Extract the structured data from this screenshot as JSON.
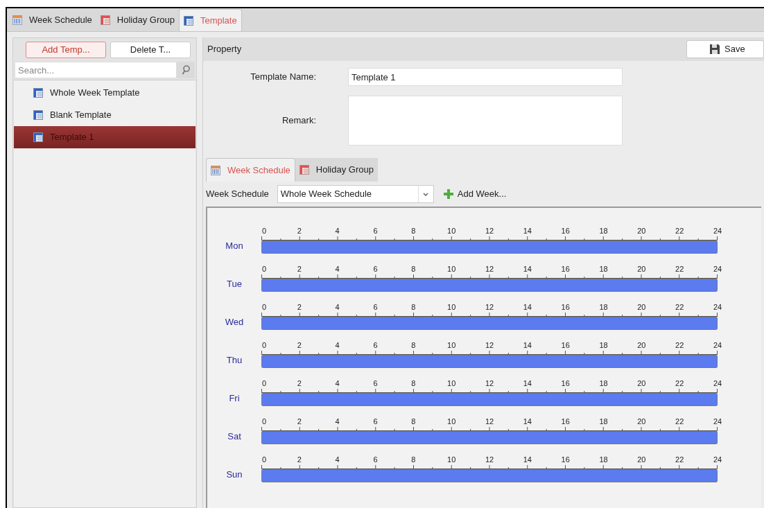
{
  "top_tabs": [
    {
      "label": "Week Schedule",
      "kind": "week",
      "selected": false
    },
    {
      "label": "Holiday Group",
      "kind": "holiday",
      "selected": false
    },
    {
      "label": "Template",
      "kind": "template",
      "selected": true
    }
  ],
  "sidebar": {
    "buttons": [
      {
        "label": "Add Temp...",
        "primary": true
      },
      {
        "label": "Delete T...",
        "primary": false
      }
    ],
    "search": {
      "placeholder": "Search..."
    },
    "items": [
      {
        "label": "Whole Week Template",
        "selected": false
      },
      {
        "label": "Blank Template",
        "selected": false
      },
      {
        "label": "Template 1",
        "selected": true
      }
    ]
  },
  "property": {
    "title": "Property",
    "save_button": "Save",
    "fields": [
      {
        "label": "Template Name:",
        "value": "Template 1",
        "kind": "line"
      },
      {
        "label": "Remark:",
        "kind": "area"
      }
    ]
  },
  "inner_tabs": [
    {
      "label": "Week Schedule",
      "kind": "week",
      "selected": true
    },
    {
      "label": "Holiday Group",
      "kind": "holiday",
      "selected": false
    }
  ],
  "week_schedule": {
    "label": "Week Schedule",
    "value": "Whole Week Schedule",
    "add_button": "Add Week..."
  },
  "days": [
    {
      "label": "Mon",
      "level": 1,
      "ticks": [
        "0",
        "2",
        "4",
        "6",
        "8",
        "10",
        "12",
        "14",
        "16",
        "18",
        "20",
        "22",
        "24"
      ]
    },
    {
      "label": "Tue",
      "level": 1,
      "ticks": [
        "0",
        "2",
        "4",
        "6",
        "8",
        "10",
        "12",
        "14",
        "16",
        "18",
        "20",
        "22",
        "24"
      ]
    },
    {
      "label": "Wed",
      "level": 1,
      "ticks": [
        "0",
        "2",
        "4",
        "6",
        "8",
        "10",
        "12",
        "14",
        "16",
        "18",
        "20",
        "22",
        "24"
      ]
    },
    {
      "label": "Thu",
      "level": 1,
      "ticks": [
        "0",
        "2",
        "4",
        "6",
        "8",
        "10",
        "12",
        "14",
        "16",
        "18",
        "20",
        "22",
        "24"
      ]
    },
    {
      "label": "Fri",
      "level": 1,
      "ticks": [
        "0",
        "2",
        "4",
        "6",
        "8",
        "10",
        "12",
        "14",
        "16",
        "18",
        "20",
        "22",
        "24"
      ]
    },
    {
      "label": "Sat",
      "level": 1,
      "ticks": [
        "0",
        "2",
        "4",
        "6",
        "8",
        "10",
        "12",
        "14",
        "16",
        "18",
        "20",
        "22",
        "24"
      ]
    },
    {
      "label": "Sun",
      "level": 1,
      "ticks": [
        "0",
        "2",
        "4",
        "6",
        "8",
        "10",
        "12",
        "14",
        "16",
        "18",
        "20",
        "22",
        "24"
      ]
    }
  ]
}
